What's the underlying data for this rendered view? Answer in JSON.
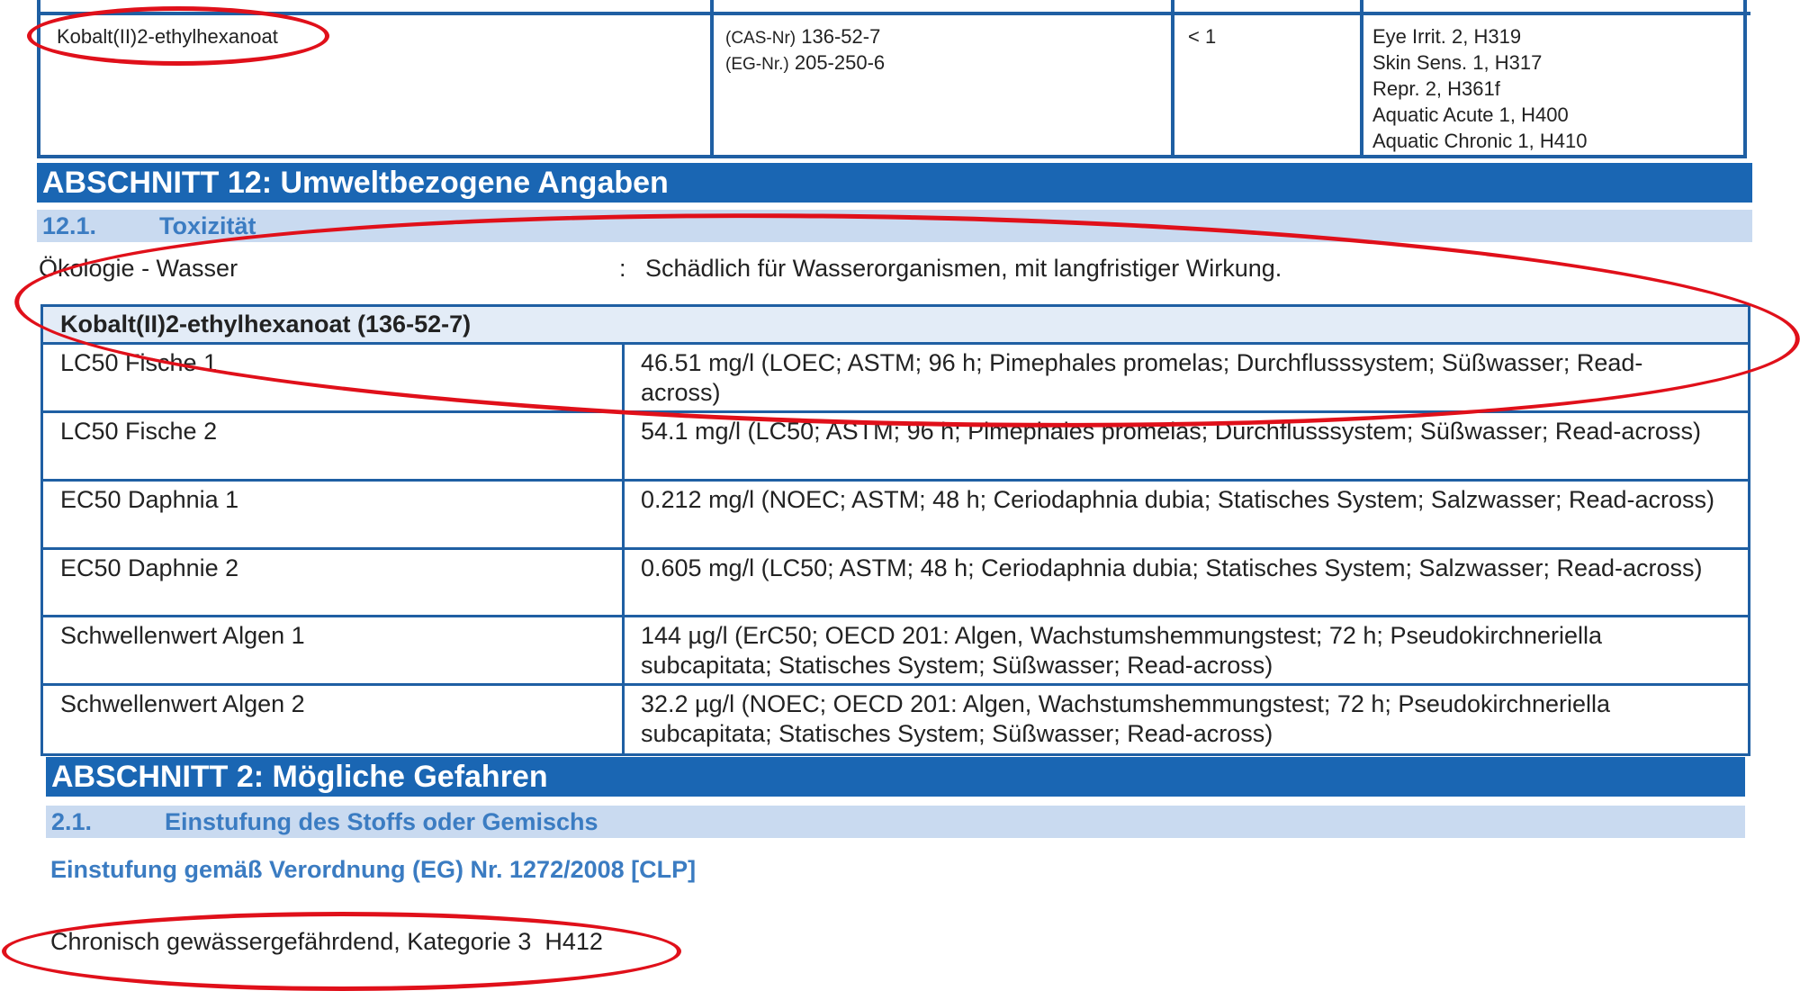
{
  "top_table": {
    "name": "Kobalt(II)2-ethylhexanoat",
    "cas_label": "(CAS-Nr)",
    "cas_value": "136-52-7",
    "eg_label": "(EG-Nr.)",
    "eg_value": "205-250-6",
    "conc": "< 1",
    "hazards": [
      "Eye Irrit. 2, H319",
      "Skin Sens. 1, H317",
      "Repr. 2, H361f",
      "Aquatic Acute 1, H400",
      "Aquatic Chronic 1, H410"
    ]
  },
  "section12": {
    "title": "ABSCHNITT 12: Umweltbezogene Angaben",
    "sub_num": "12.1.",
    "sub_title": "Toxizität",
    "eco_label": "Ökologie - Wasser",
    "eco_sep": ":",
    "eco_value": "Schädlich für Wasserorganismen, mit langfristiger Wirkung."
  },
  "tox_table": {
    "header": "Kobalt(II)2-ethylhexanoat (136-52-7)",
    "rows": [
      {
        "label": "LC50 Fische 1",
        "value": "46.51 mg/l (LOEC; ASTM; 96 h; Pimephales promelas; Durchflusssystem; Süßwasser; Read-across)"
      },
      {
        "label": "LC50 Fische 2",
        "value": "54.1 mg/l (LC50; ASTM; 96 h; Pimephales promelas; Durchflusssystem; Süßwasser; Read-across)"
      },
      {
        "label": "EC50 Daphnia 1",
        "value": "0.212 mg/l (NOEC; ASTM; 48 h; Ceriodaphnia dubia; Statisches System; Salzwasser; Read-across)"
      },
      {
        "label": "EC50 Daphnie 2",
        "value": "0.605 mg/l (LC50; ASTM; 48 h; Ceriodaphnia dubia; Statisches System; Salzwasser; Read-across)"
      },
      {
        "label": "Schwellenwert Algen 1",
        "value": "144 µg/l (ErC50; OECD 201: Algen, Wachstumshemmungstest; 72 h; Pseudokirchneriella subcapitata; Statisches System; Süßwasser; Read-across)"
      },
      {
        "label": "Schwellenwert Algen 2",
        "value": "32.2 µg/l (NOEC; OECD 201: Algen, Wachstumshemmungstest; 72 h; Pseudokirchneriella subcapitata; Statisches System; Süßwasser; Read-across)"
      }
    ]
  },
  "section2": {
    "title": "ABSCHNITT 2: Mögliche Gefahren",
    "sub_num": "2.1.",
    "sub_title": "Einstufung des Stoffs oder Gemischs",
    "regulation": "Einstufung gemäß Verordnung (EG) Nr. 1272/2008 [CLP]",
    "classification": "Chronisch gewässergefährdend, Kategorie 3",
    "h_code": "H412"
  },
  "colors": {
    "section_blue": "#1a66b3",
    "sub_bg": "#c9daf0",
    "annotation_red": "#e0101a"
  }
}
